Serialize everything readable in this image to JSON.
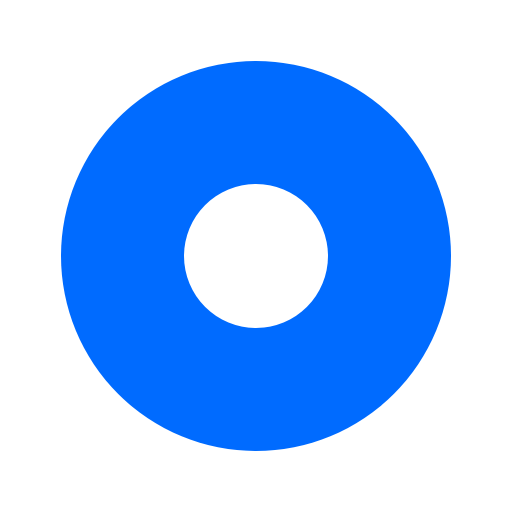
{
  "icon": {
    "name": "ring-icon",
    "shape": "ring",
    "colors": {
      "ring": "#006bff",
      "background": "#ffffff",
      "hole": "#ffffff"
    }
  }
}
